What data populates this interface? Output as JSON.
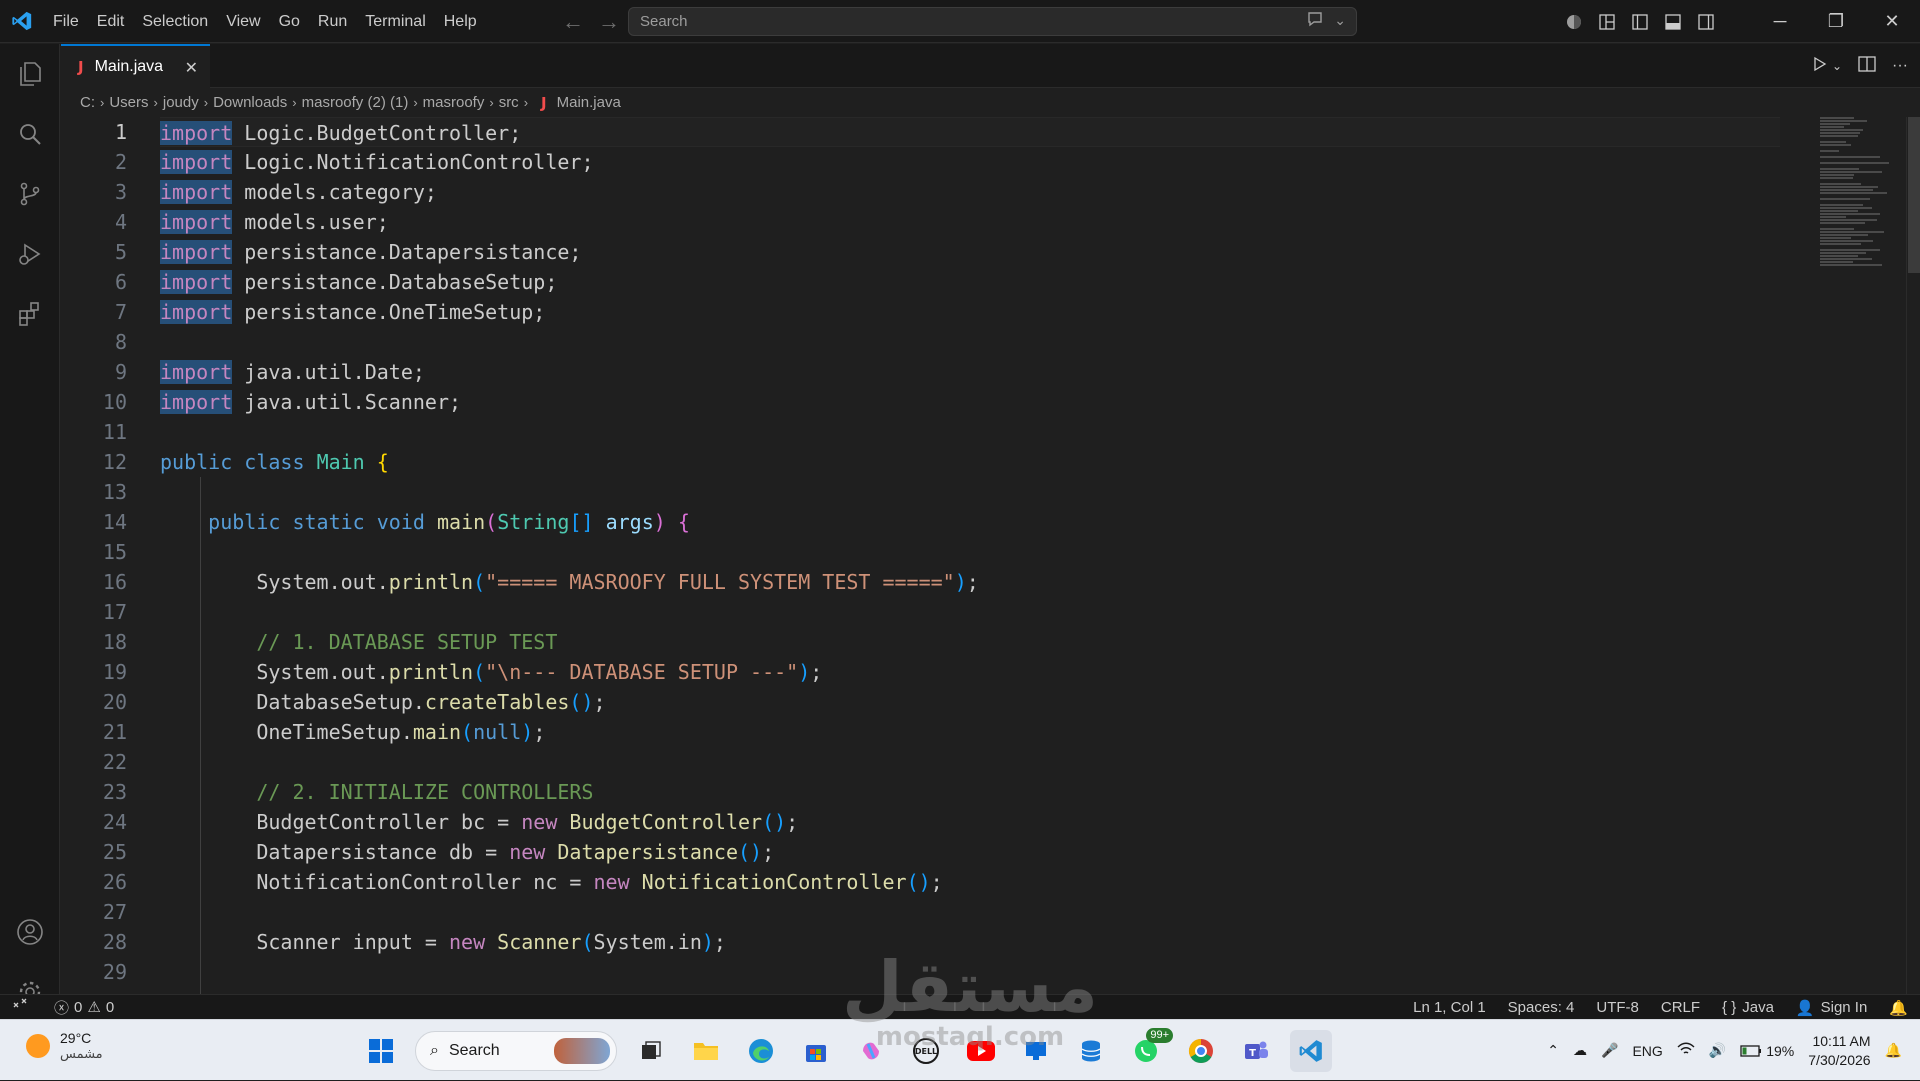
{
  "menu": [
    "File",
    "Edit",
    "Selection",
    "View",
    "Go",
    "Run",
    "Terminal",
    "Help"
  ],
  "search": {
    "placeholder": "Search"
  },
  "tab": {
    "icon_letter": "J",
    "label": "Main.java"
  },
  "breadcrumb": [
    "C:",
    "Users",
    "joudy",
    "Downloads",
    "masroofy (2) (1)",
    "masroofy",
    "src"
  ],
  "breadcrumb_file": {
    "icon_letter": "J",
    "label": "Main.java"
  },
  "line_numbers": [
    "1",
    "2",
    "3",
    "4",
    "5",
    "6",
    "7",
    "8",
    "9",
    "10",
    "11",
    "12",
    "13",
    "14",
    "15",
    "16",
    "17",
    "18",
    "19",
    "20",
    "21",
    "22",
    "23",
    "24",
    "25",
    "26",
    "27",
    "28",
    "29"
  ],
  "code_lines": [
    [
      {
        "t": "import",
        "c": "kw-imp"
      },
      {
        "t": " Logic.BudgetController;"
      }
    ],
    [
      {
        "t": "import",
        "c": "kw-imp"
      },
      {
        "t": " Logic.NotificationController;"
      }
    ],
    [
      {
        "t": "import",
        "c": "kw-imp"
      },
      {
        "t": " models.category;"
      }
    ],
    [
      {
        "t": "import",
        "c": "kw-imp"
      },
      {
        "t": " models.user;"
      }
    ],
    [
      {
        "t": "import",
        "c": "kw-imp"
      },
      {
        "t": " persistance.Datapersistance;"
      }
    ],
    [
      {
        "t": "import",
        "c": "kw-imp"
      },
      {
        "t": " persistance.DatabaseSetup;"
      }
    ],
    [
      {
        "t": "import",
        "c": "kw-imp"
      },
      {
        "t": " persistance.OneTimeSetup;"
      }
    ],
    [],
    [
      {
        "t": "import",
        "c": "kw-imp"
      },
      {
        "t": " java.util.Date;"
      }
    ],
    [
      {
        "t": "import",
        "c": "kw-imp"
      },
      {
        "t": " java.util.Scanner;"
      }
    ],
    [],
    [
      {
        "t": "public",
        "c": "kw"
      },
      {
        "t": " "
      },
      {
        "t": "class",
        "c": "kw"
      },
      {
        "t": " "
      },
      {
        "t": "Main",
        "c": "cls"
      },
      {
        "t": " "
      },
      {
        "t": "{",
        "c": "br1"
      }
    ],
    [],
    [
      {
        "t": "    "
      },
      {
        "t": "public",
        "c": "kw"
      },
      {
        "t": " "
      },
      {
        "t": "static",
        "c": "kw"
      },
      {
        "t": " "
      },
      {
        "t": "void",
        "c": "kw"
      },
      {
        "t": " "
      },
      {
        "t": "main",
        "c": "fn"
      },
      {
        "t": "(",
        "c": "br2"
      },
      {
        "t": "String",
        "c": "cls"
      },
      {
        "t": "[]",
        "c": "br3"
      },
      {
        "t": " "
      },
      {
        "t": "args",
        "c": "var"
      },
      {
        "t": ")",
        "c": "br2"
      },
      {
        "t": " "
      },
      {
        "t": "{",
        "c": "br2"
      }
    ],
    [],
    [
      {
        "t": "        System.out."
      },
      {
        "t": "println",
        "c": "fn"
      },
      {
        "t": "(",
        "c": "br3"
      },
      {
        "t": "\"===== MASROOFY FULL SYSTEM TEST =====\"",
        "c": "str"
      },
      {
        "t": ")",
        "c": "br3"
      },
      {
        "t": ";"
      }
    ],
    [],
    [
      {
        "t": "        // 1. DATABASE SETUP TEST",
        "c": "com"
      }
    ],
    [
      {
        "t": "        System.out."
      },
      {
        "t": "println",
        "c": "fn"
      },
      {
        "t": "(",
        "c": "br3"
      },
      {
        "t": "\"\\n--- DATABASE SETUP ---\"",
        "c": "str"
      },
      {
        "t": ")",
        "c": "br3"
      },
      {
        "t": ";"
      }
    ],
    [
      {
        "t": "        DatabaseSetup."
      },
      {
        "t": "createTables",
        "c": "fn"
      },
      {
        "t": "()",
        "c": "br3"
      },
      {
        "t": ";"
      }
    ],
    [
      {
        "t": "        OneTimeSetup."
      },
      {
        "t": "main",
        "c": "fn"
      },
      {
        "t": "(",
        "c": "br3"
      },
      {
        "t": "null",
        "c": "kw"
      },
      {
        "t": ")",
        "c": "br3"
      },
      {
        "t": ";"
      }
    ],
    [],
    [
      {
        "t": "        // 2. INITIALIZE CONTROLLERS",
        "c": "com"
      }
    ],
    [
      {
        "t": "        BudgetController bc = "
      },
      {
        "t": "new",
        "c": "kwc"
      },
      {
        "t": " "
      },
      {
        "t": "BudgetController",
        "c": "fn"
      },
      {
        "t": "()",
        "c": "br3"
      },
      {
        "t": ";"
      }
    ],
    [
      {
        "t": "        Datapersistance db = "
      },
      {
        "t": "new",
        "c": "kwc"
      },
      {
        "t": " "
      },
      {
        "t": "Datapersistance",
        "c": "fn"
      },
      {
        "t": "()",
        "c": "br3"
      },
      {
        "t": ";"
      }
    ],
    [
      {
        "t": "        NotificationController nc = "
      },
      {
        "t": "new",
        "c": "kwc"
      },
      {
        "t": " "
      },
      {
        "t": "NotificationController",
        "c": "fn"
      },
      {
        "t": "()",
        "c": "br3"
      },
      {
        "t": ";"
      }
    ],
    [],
    [
      {
        "t": "        Scanner input = "
      },
      {
        "t": "new",
        "c": "kwc"
      },
      {
        "t": " "
      },
      {
        "t": "Scanner",
        "c": "fn"
      },
      {
        "t": "(",
        "c": "br3"
      },
      {
        "t": "System.in"
      },
      {
        "t": ")",
        "c": "br3"
      },
      {
        "t": ";"
      }
    ],
    []
  ],
  "status": {
    "errors": "0",
    "warnings": "0",
    "position": "Ln 1, Col 1",
    "spaces": "Spaces: 4",
    "encoding": "UTF-8",
    "eol": "CRLF",
    "language": "Java",
    "signin": "Sign In"
  },
  "taskbar": {
    "temp": "29°C",
    "weather_desc": "مشمس",
    "search_label": "Search",
    "whatsapp_badge": "99+",
    "lang": "ENG",
    "battery": "19%",
    "time": "10:11 AM",
    "date": "7/30/2026"
  },
  "watermark": {
    "text": "مستقل",
    "sub": "mostaql.com"
  },
  "colors": {
    "accent": "#0078d4",
    "editor_bg": "#1f1f1f",
    "keyword": "#569cd6",
    "import_kw": "#c586c0",
    "type": "#4ec9b0",
    "function": "#dcdcaa",
    "string": "#ce9178",
    "comment": "#6a9955"
  }
}
